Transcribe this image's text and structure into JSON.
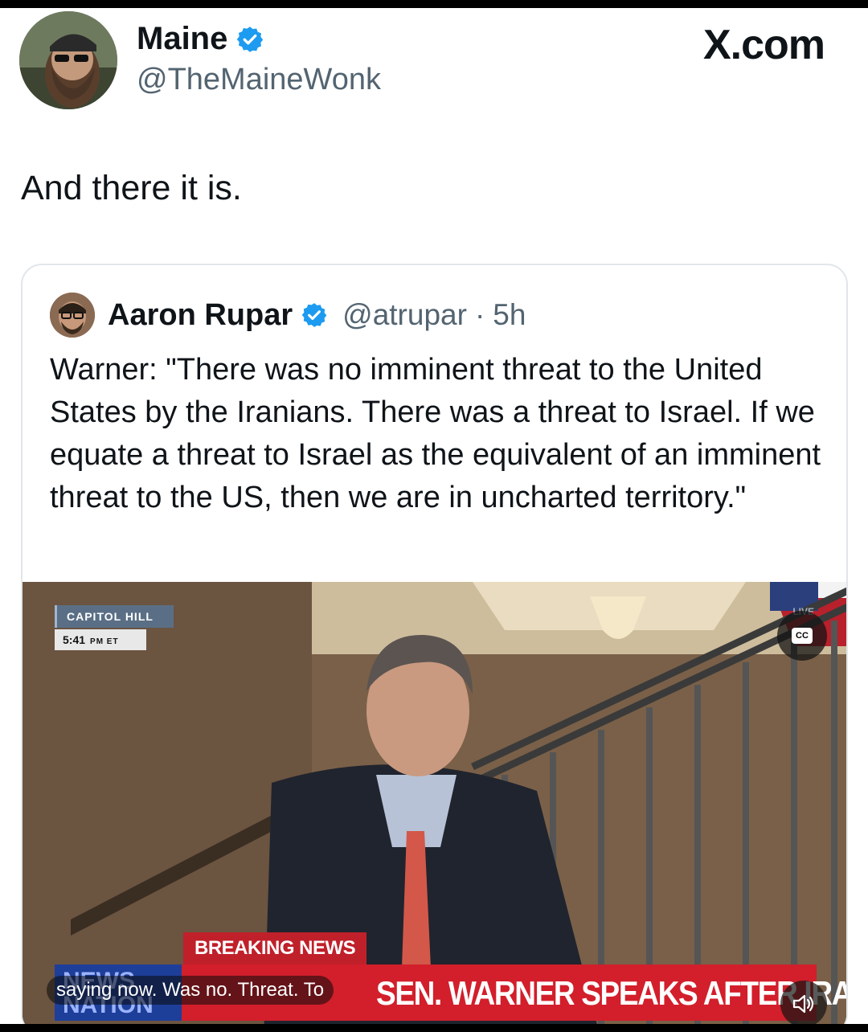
{
  "post": {
    "author_name": "Maine",
    "author_handle": "@TheMaineWonk",
    "brand": "X.com",
    "text": "And there it is."
  },
  "quoted_post": {
    "author_name": "Aaron Rupar",
    "author_handle": "@atrupar",
    "separator": "·",
    "time": "5h",
    "text": "Warner: \"There was no imminent threat to the United States by the Iranians. There was a threat to Israel. If we equate a threat to Israel as the equivalent of an imminent threat to the US, then we are in uncharted territory.\""
  },
  "video": {
    "location": "CAPITOL HILL",
    "time": "5:41",
    "time_suffix": "PM ET",
    "live_label": "LIVE",
    "cc_label": "CC",
    "breaking_label": "BREAKING NEWS",
    "network_logo": "NEWS NATION",
    "headline": "SEN. WARNER SPEAKS AFTER IRAN BRIEFING",
    "caption": "saying now. Was no. Threat. To"
  },
  "colors": {
    "verified": "#1d9bf0",
    "breaking_red": "#c0202a",
    "network_blue": "#1d3f9a"
  },
  "icons": [
    "verified-badge-icon",
    "closed-captions-icon",
    "speaker-icon"
  ]
}
